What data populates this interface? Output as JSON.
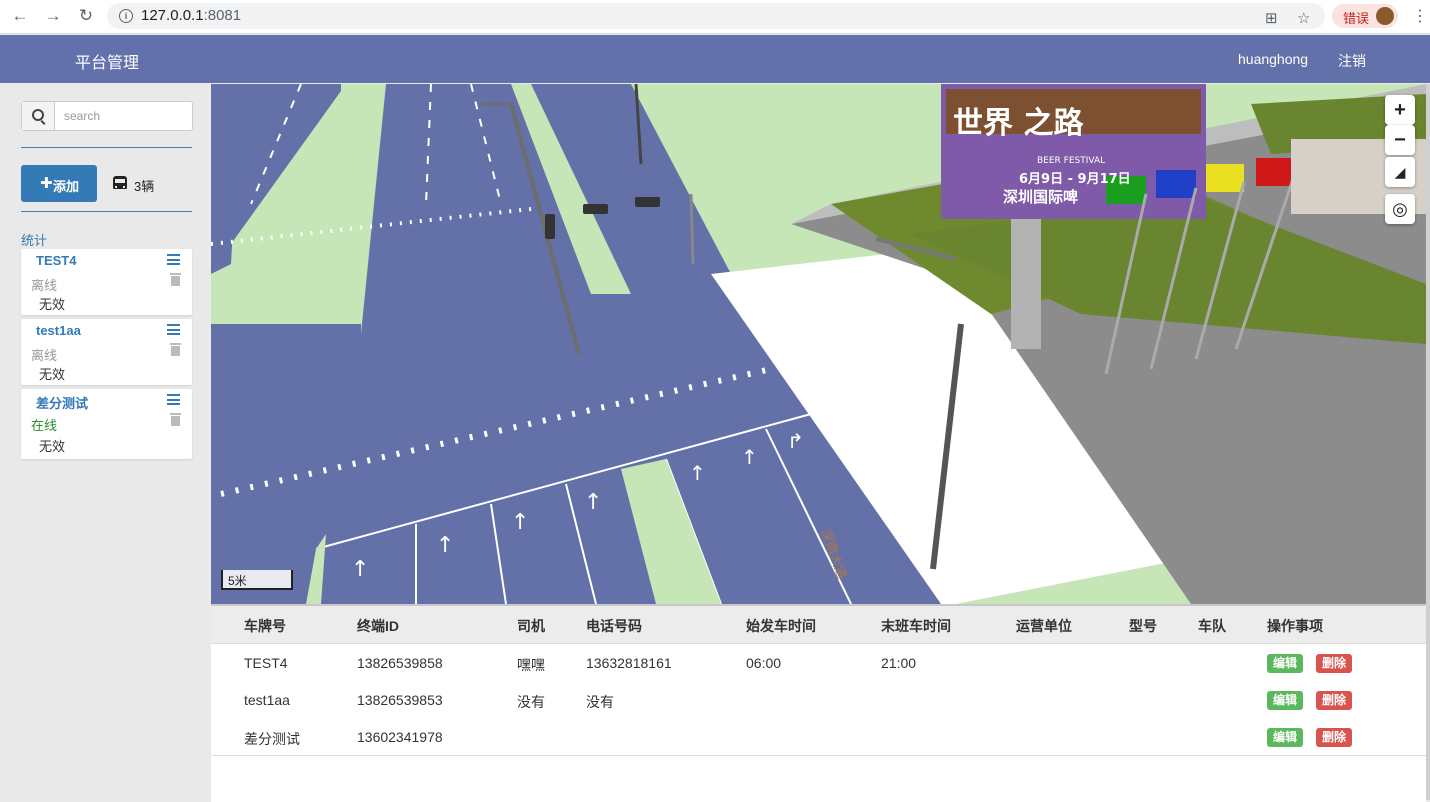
{
  "browser": {
    "url_host": "127.0.0.1",
    "url_port": ":8081",
    "error_badge": "错误"
  },
  "navbar": {
    "brand": "平台管理",
    "user": "huanghong",
    "logout": "注销"
  },
  "sidebar": {
    "search_placeholder": "search",
    "add_label": "添加",
    "vehicle_count": "3辆",
    "stats_label": "统计",
    "vehicles": [
      {
        "name": "TEST4",
        "status": "离线",
        "status_color": "#999999",
        "validity": "无效"
      },
      {
        "name": "test1aa",
        "status": "离线",
        "status_color": "#999999",
        "validity": "无效"
      },
      {
        "name": "差分测试",
        "status": "在线",
        "status_color": "#2e8b2e",
        "validity": "无效"
      }
    ]
  },
  "map": {
    "scale_label": "5米",
    "zoom_in": "+",
    "zoom_out": "−",
    "billboard": {
      "title": "世界 之路",
      "subtitle": "BEER FESTIVAL",
      "dates": "6月9日 - 9月17日",
      "venue": "深圳国际啤"
    },
    "road_label": "深南大道"
  },
  "table": {
    "headers": [
      "车牌号",
      "终端ID",
      "司机",
      "电话号码",
      "始发车时间",
      "末班车时间",
      "运营单位",
      "型号",
      "车队",
      "操作事项"
    ],
    "rows": [
      {
        "plate": "TEST4",
        "terminal": "13826539858",
        "driver": "嘿嘿",
        "phone": "13632818161",
        "first": "06:00",
        "last": "21:00"
      },
      {
        "plate": "test1aa",
        "terminal": "13826539853",
        "driver": "没有",
        "phone": "没有",
        "first": "",
        "last": ""
      },
      {
        "plate": "差分测试",
        "terminal": "13602341978",
        "driver": "",
        "phone": "",
        "first": "",
        "last": ""
      }
    ],
    "edit_label": "编辑",
    "delete_label": "删除"
  },
  "colors": {
    "navbar": "#6271a9",
    "primary": "#337ab7",
    "success": "#5cb85c",
    "danger": "#d9534f",
    "road": "#6371a8",
    "grass": "#c5e8b6"
  }
}
